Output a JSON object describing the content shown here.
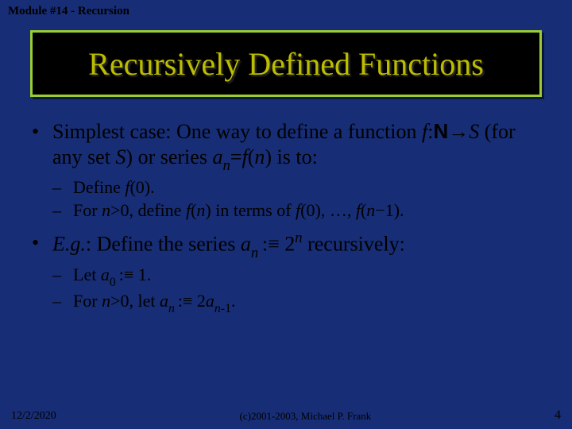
{
  "header": "Module #14 - Recursion",
  "title": "Recursively Defined Functions",
  "bullets": {
    "b1_pre": "Simplest case: One way to define a function ",
    "b1_f": "f",
    "b1_colon": ":",
    "b1_N": "N",
    "b1_arrow": "→",
    "b1_S": "S",
    "b1_mid": " (for any set ",
    "b1_S2": "S",
    "b1_mid2": ") or series ",
    "b1_a": "a",
    "b1_n": "n",
    "b1_eq": "=",
    "b1_f2": "f",
    "b1_par1": "(",
    "b1_n2": "n",
    "b1_par2": ") is to:",
    "s1a_pre": "Define ",
    "s1a_f": "f",
    "s1a_rest": "(0).",
    "s1b_pre": "For ",
    "s1b_n": "n",
    "s1b_gt": ">0, define ",
    "s1b_f": "f",
    "s1b_par1": "(",
    "s1b_n2": "n",
    "s1b_mid": ") in terms of ",
    "s1b_f2": "f",
    "s1b_seq": "(0), …, ",
    "s1b_f3": "f",
    "s1b_par2": "(",
    "s1b_n3": "n",
    "s1b_end": "−1).",
    "b2_eg": "E.g.",
    "b2_pre": ": Define the series ",
    "b2_a": "a",
    "b2_n": "n ",
    "b2_def": ":≡ 2",
    "b2_exp": "n",
    "b2_end": " recursively:",
    "s2a_pre": "Let ",
    "s2a_a": "a",
    "s2a_0": "0 ",
    "s2a_end": ":≡ 1.",
    "s2b_pre": "For ",
    "s2b_n": "n",
    "s2b_mid": ">0, let ",
    "s2b_a": "a",
    "s2b_idx": "n ",
    "s2b_def": ":≡ 2",
    "s2b_a2": "a",
    "s2b_idx2": "n-",
    "s2b_one": "1",
    "s2b_dot": "."
  },
  "footer": {
    "date": "12/2/2020",
    "copy": "(c)2001-2003, Michael P. Frank",
    "page": "4"
  }
}
